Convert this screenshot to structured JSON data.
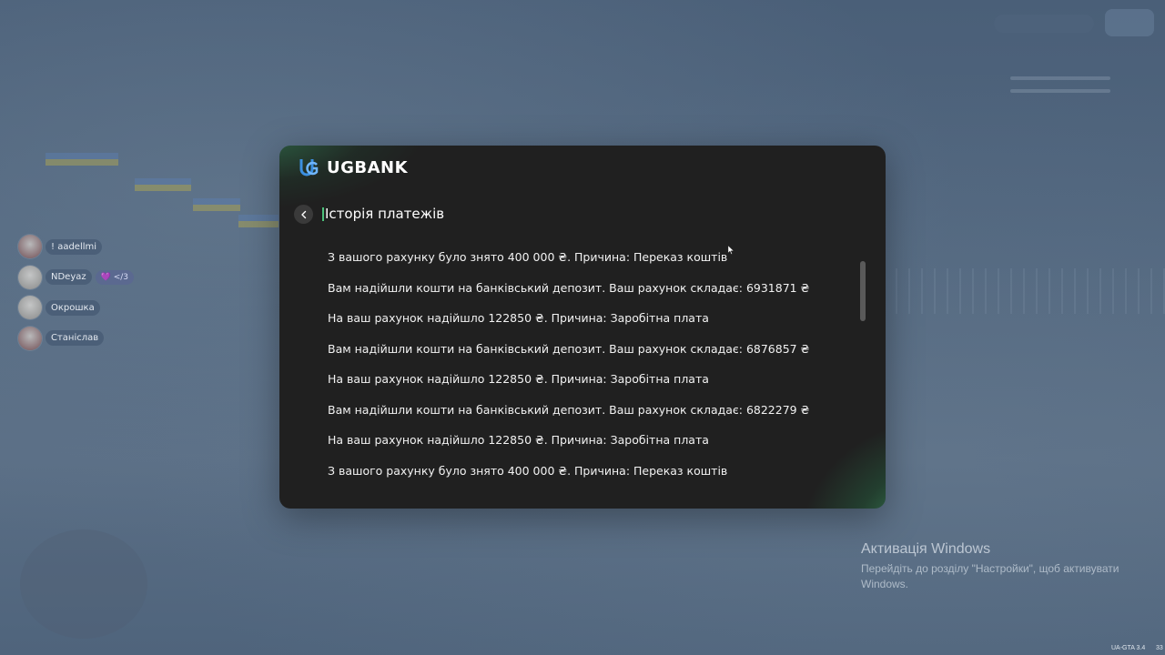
{
  "bank": {
    "name": "UGBANK",
    "page_title": "Історія платежів"
  },
  "history": [
    "З вашого рахунку було знято 400 000 ₴. Причина: Переказ коштів",
    "Вам надійшли кошти на банківський депозит. Ваш рахунок складає: 6931871 ₴",
    "На ваш рахунок надійшло 122850 ₴. Причина: Заробітна плата",
    "Вам надійшли кошти на банківський депозит. Ваш рахунок складає: 6876857 ₴",
    "На ваш рахунок надійшло 122850 ₴. Причина: Заробітна плата",
    "Вам надійшли кошти на банківський депозит. Ваш рахунок складає: 6822279 ₴",
    "На ваш рахунок надійшло 122850 ₴. Причина: Заробітна плата",
    "З вашого рахунку було знято 400 000 ₴. Причина: Переказ коштів"
  ],
  "players": [
    {
      "name": "! aadellmi"
    },
    {
      "name": "NDeyaz",
      "badge": "💜 </3"
    },
    {
      "name": "Окрошка"
    },
    {
      "name": "Станіслав"
    }
  ],
  "windows_activation": {
    "title": "Активація Windows",
    "subtitle": "Перейдіть до розділу \"Настройки\", щоб активувати Windows."
  },
  "version": "UA-GTA 3.4",
  "version_num": "33",
  "colors": {
    "accent": "#4cc07a",
    "modal_bg": "#202020"
  }
}
